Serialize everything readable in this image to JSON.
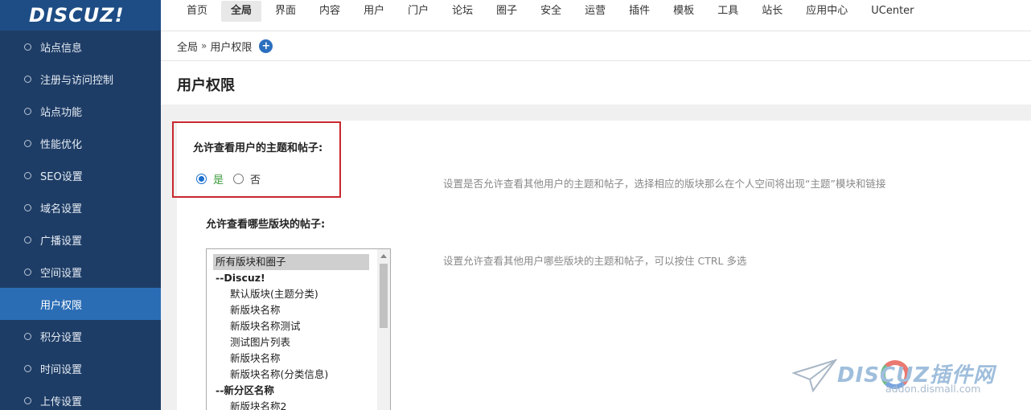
{
  "brand": {
    "logo_text": "DISCUZ!"
  },
  "topnav": {
    "items": [
      {
        "label": "首页"
      },
      {
        "label": "全局"
      },
      {
        "label": "界面"
      },
      {
        "label": "内容"
      },
      {
        "label": "用户"
      },
      {
        "label": "门户"
      },
      {
        "label": "论坛"
      },
      {
        "label": "圈子"
      },
      {
        "label": "安全"
      },
      {
        "label": "运营"
      },
      {
        "label": "插件"
      },
      {
        "label": "模板"
      },
      {
        "label": "工具"
      },
      {
        "label": "站长"
      },
      {
        "label": "应用中心"
      },
      {
        "label": "UCenter"
      }
    ],
    "active_index": 1
  },
  "sidebar": {
    "items": [
      {
        "label": "站点信息"
      },
      {
        "label": "注册与访问控制"
      },
      {
        "label": "站点功能"
      },
      {
        "label": "性能优化"
      },
      {
        "label": "SEO设置"
      },
      {
        "label": "域名设置"
      },
      {
        "label": "广播设置"
      },
      {
        "label": "空间设置"
      },
      {
        "label": "用户权限"
      },
      {
        "label": "积分设置"
      },
      {
        "label": "时间设置"
      },
      {
        "label": "上传设置"
      }
    ],
    "active_index": 8
  },
  "breadcrumb": {
    "root": "全局",
    "separator": "»",
    "current": "用户权限",
    "add_icon": "+"
  },
  "page": {
    "title": "用户权限"
  },
  "setting_view_posts": {
    "label": "允许查看用户的主题和帖子:",
    "options": {
      "yes": "是",
      "no": "否"
    },
    "selected": "yes",
    "description": "设置是否允许查看其他用户的主题和帖子，选择相应的版块那么在个人空间将出现“主题”模块和链接"
  },
  "setting_forums": {
    "label": "允许查看哪些版块的帖子:",
    "description": "设置允许查看其他用户哪些版块的主题和帖子，可以按住 CTRL 多选",
    "options": [
      {
        "label": "所有版块和圈子",
        "kind": "selected"
      },
      {
        "label": "--Discuz!",
        "kind": "group"
      },
      {
        "label": "默认版块(主题分类)",
        "kind": "child"
      },
      {
        "label": "新版块名称",
        "kind": "child"
      },
      {
        "label": "新版块名称测试",
        "kind": "child"
      },
      {
        "label": "测试图片列表",
        "kind": "child"
      },
      {
        "label": "新版块名称",
        "kind": "child"
      },
      {
        "label": "新版块名称(分类信息)",
        "kind": "child"
      },
      {
        "label": "--新分区名称",
        "kind": "group"
      },
      {
        "label": "新版块名称2",
        "kind": "child"
      }
    ]
  },
  "watermark": {
    "main": "DISCUZ插件网",
    "sub": "addon.dismall.com"
  },
  "colors": {
    "sidebar_bg": "#1e3d66",
    "sidebar_active": "#2b6db5",
    "highlight": "#c8272d",
    "radio_yes": "#3a9a3a"
  }
}
